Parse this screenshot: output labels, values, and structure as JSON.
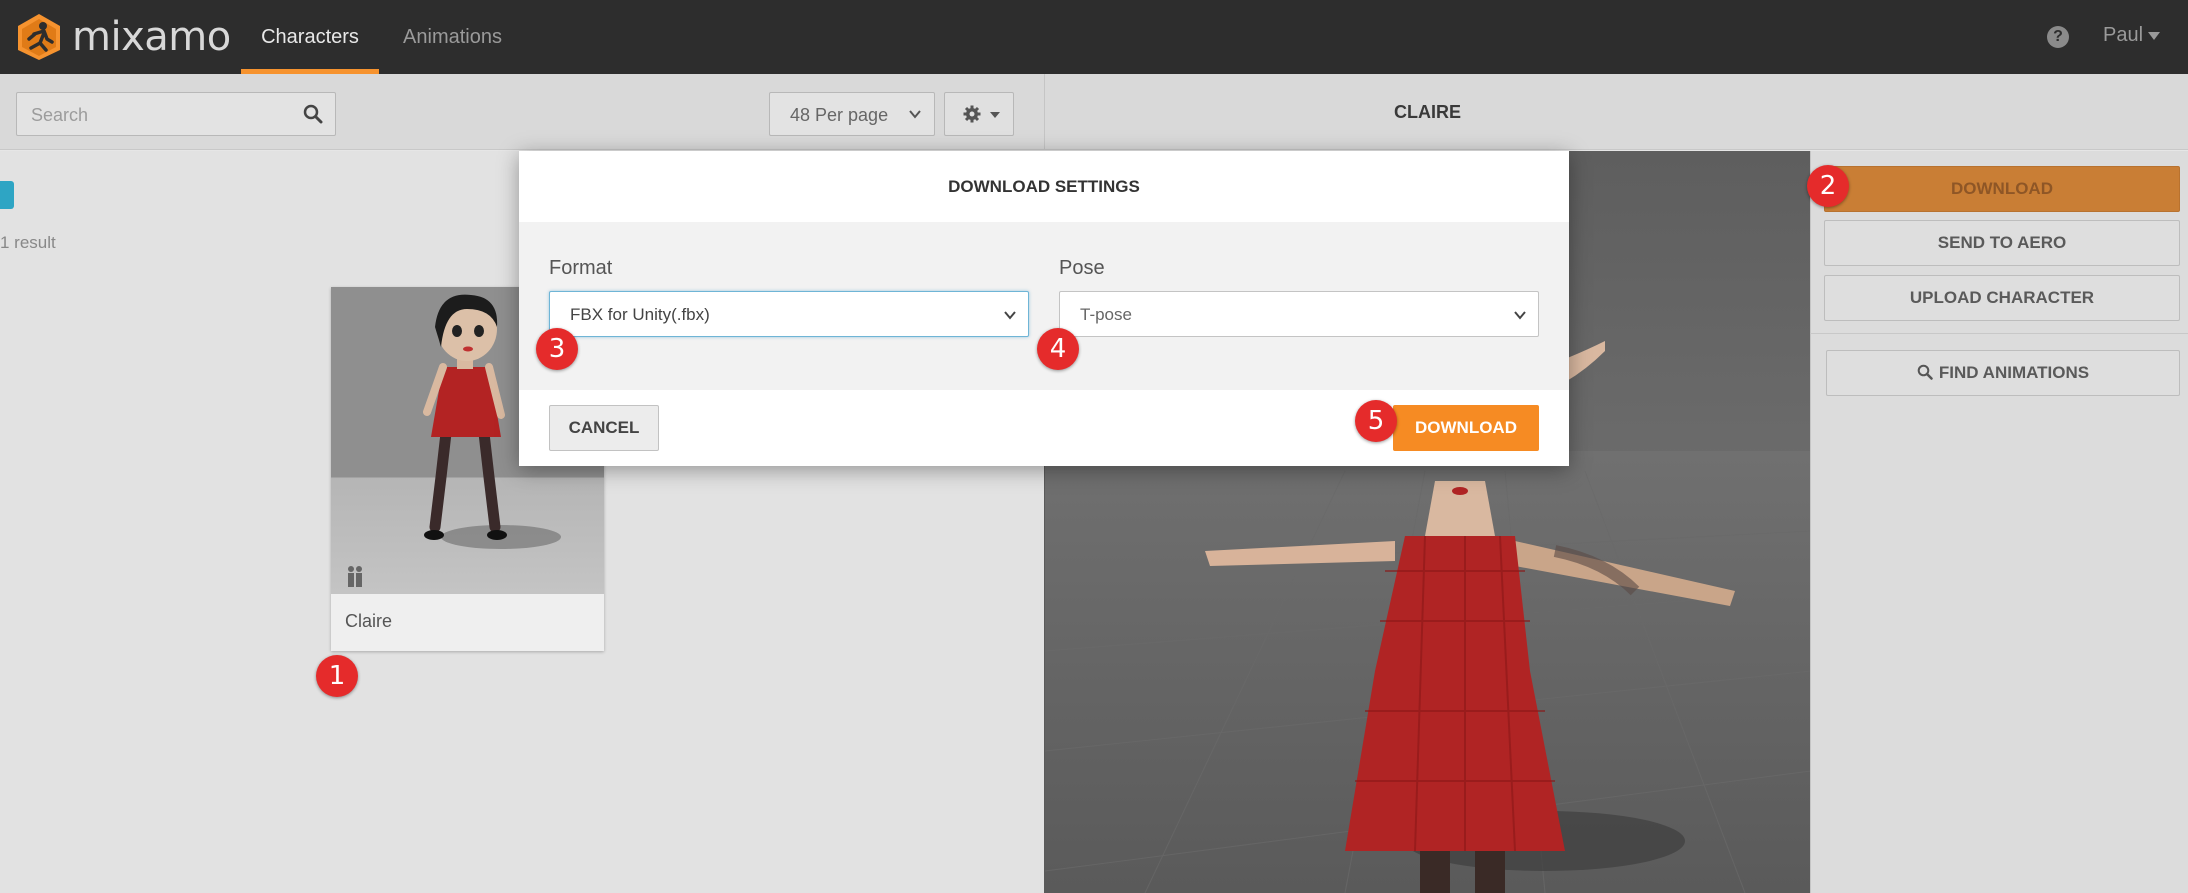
{
  "app": {
    "brand": "mixamo",
    "nav_tabs": [
      {
        "label": "Characters",
        "active": true
      },
      {
        "label": "Animations",
        "active": false
      }
    ],
    "user": "Paul",
    "accent_color": "#f6932f"
  },
  "browser": {
    "search_placeholder": "Search",
    "per_page": "48 Per page",
    "result_count": "1 result",
    "cards": [
      {
        "name": "Claire"
      }
    ]
  },
  "viewer": {
    "title": "CLAIRE"
  },
  "actions": {
    "download": "DOWNLOAD",
    "send_to_aero": "SEND TO AERO",
    "upload_character": "UPLOAD CHARACTER",
    "find_animations": "FIND ANIMATIONS"
  },
  "modal": {
    "title": "DOWNLOAD SETTINGS",
    "format_label": "Format",
    "format_value": "FBX for Unity(.fbx)",
    "pose_label": "Pose",
    "pose_value": "T-pose",
    "cancel": "CANCEL",
    "download": "DOWNLOAD"
  },
  "badges": [
    "1",
    "2",
    "3",
    "4",
    "5"
  ]
}
